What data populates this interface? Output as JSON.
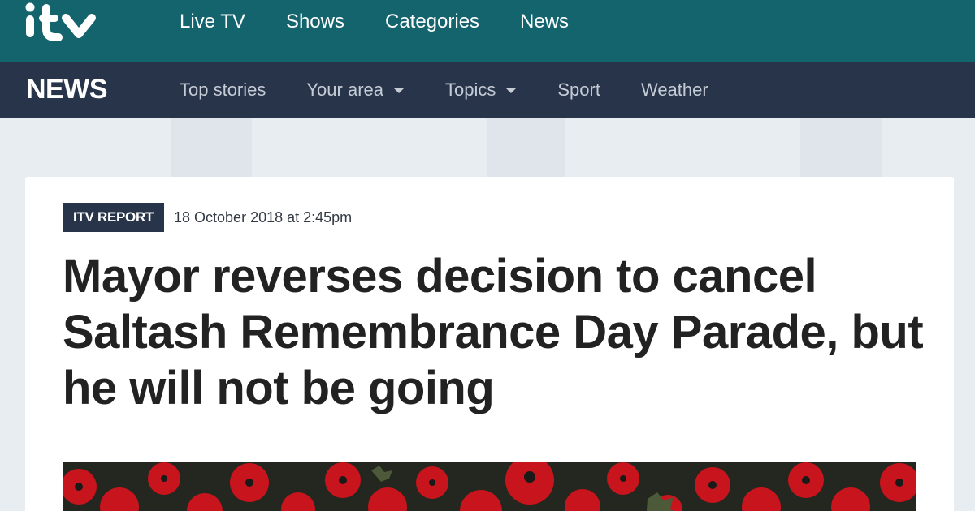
{
  "brand": {
    "logo_text": "itv",
    "news_label": "NEWS"
  },
  "top_nav": [
    {
      "label": "Live TV"
    },
    {
      "label": "Shows"
    },
    {
      "label": "Categories"
    },
    {
      "label": "News"
    }
  ],
  "sub_nav": [
    {
      "label": "Top stories",
      "dropdown": false
    },
    {
      "label": "Your area",
      "dropdown": true
    },
    {
      "label": "Topics",
      "dropdown": true
    },
    {
      "label": "Sport",
      "dropdown": false
    },
    {
      "label": "Weather",
      "dropdown": false
    }
  ],
  "article": {
    "badge": "ITV REPORT",
    "date": "18 October 2018 at 2:45pm",
    "headline": "Mayor reverses decision to cancel Saltash Remembrance Day Parade, but he will not be going",
    "hero_image": "poppies"
  },
  "colors": {
    "top_bar": "#14646e",
    "news_bar": "#27344a",
    "page_bg": "#e8edf1",
    "poppy_red": "#d0121b"
  }
}
